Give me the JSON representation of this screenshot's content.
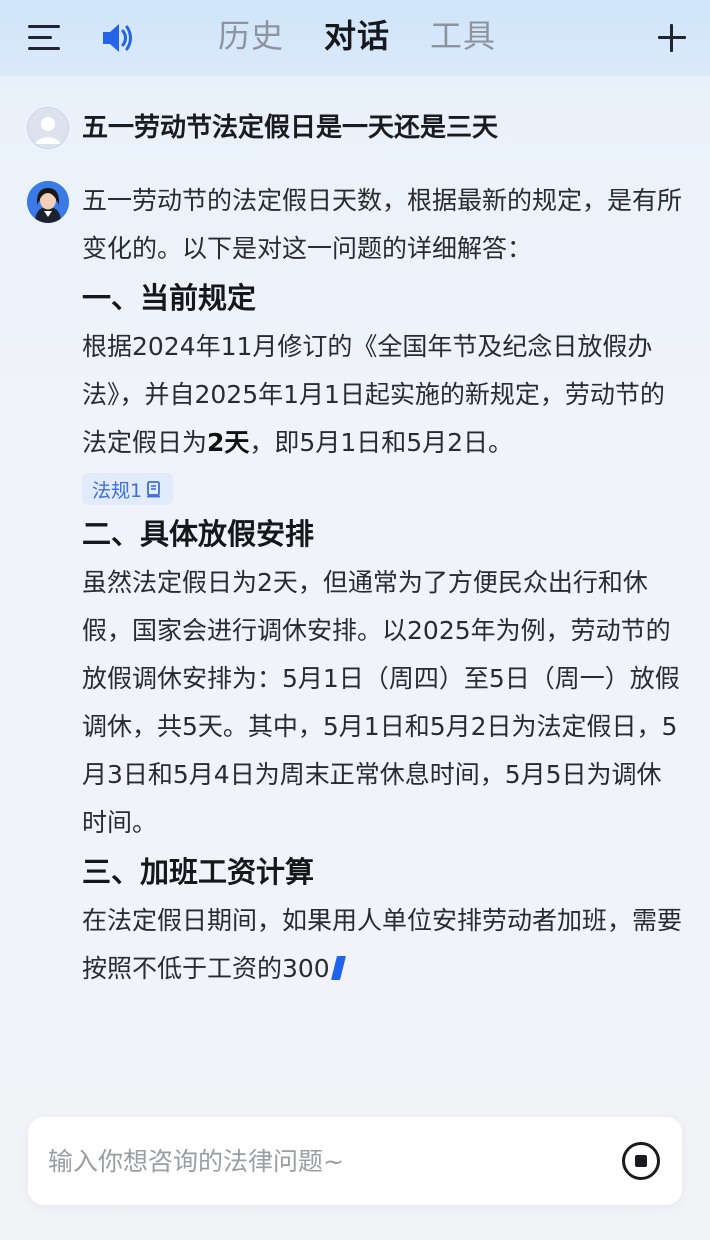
{
  "header": {
    "menu_icon": "hamburger-menu-icon",
    "speaker_icon": "speaker-volume-icon",
    "tabs": [
      {
        "label": "历史",
        "active": false
      },
      {
        "label": "对话",
        "active": true
      },
      {
        "label": "工具",
        "active": false
      }
    ],
    "new_icon": "plus-icon"
  },
  "conversation": {
    "question": "五一劳动节法定假日是一天还是三天",
    "answer": {
      "intro": "五一劳动节的法定假日天数，根据最新的规定，是有所变化的。以下是对这一问题的详细解答：",
      "section1": {
        "heading": "一、当前规定",
        "text_before": "根据2024年11月修订的《全国年节及纪念日放假办法》，并自2025年1月1日起实施的新规定，劳动节的法定假日为",
        "text_bold": "2天",
        "text_after": "，即5月1日和5月2日。",
        "citation": "法规1"
      },
      "section2": {
        "heading": "二、具体放假安排",
        "text": "虽然法定假日为2天，但通常为了方便民众出行和休假，国家会进行调休安排。以2025年为例，劳动节的放假调休安排为：5月1日（周四）至5日（周一）放假调休，共5天。其中，5月1日和5月2日为法定假日，5月3日和5月4日为周末正常休息时间，5月5日为调休时间。"
      },
      "section3": {
        "heading": "三、加班工资计算",
        "text": "在法定假日期间，如果用人单位安排劳动者加班，需要按照不低于工资的300"
      }
    }
  },
  "input": {
    "placeholder": "输入你想咨询的法律问题~",
    "stop_icon": "stop-circle-icon"
  },
  "colors": {
    "accent": "#1e63e9",
    "citation_bg": "#e2ebfb",
    "citation_text": "#3f6fd8"
  }
}
